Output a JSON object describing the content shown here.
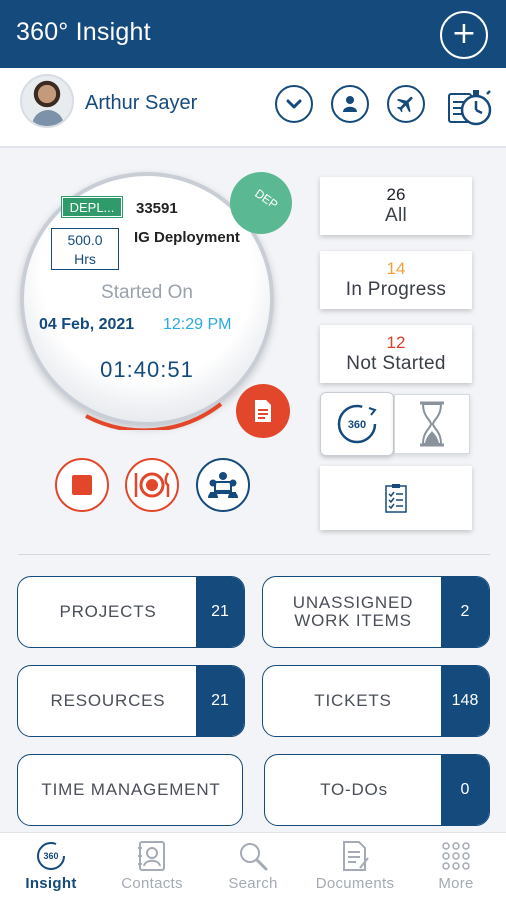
{
  "header": {
    "title": "360° Insight"
  },
  "user": {
    "name": "Arthur Sayer"
  },
  "task": {
    "tag": "DEPL...",
    "id": "33591",
    "badge": "DEP",
    "hours_value": "500.0",
    "hours_unit": "Hrs",
    "project": "IG Deployment",
    "started_label": "Started On",
    "started_date": "04 Feb, 2021",
    "started_time": "12:29 PM",
    "elapsed": "01:40:51"
  },
  "stats": [
    {
      "count": "26",
      "label": "All",
      "color": "#1d2128"
    },
    {
      "count": "14",
      "label": "In Progress",
      "color": "#f0a13a"
    },
    {
      "count": "12",
      "label": "Not Started",
      "color": "#d9412b"
    }
  ],
  "toggle": {
    "left_label": "360"
  },
  "tiles": {
    "projects": {
      "label": "PROJECTS",
      "count": "21"
    },
    "unassigned": {
      "label_line1": "UNASSIGNED",
      "label_line2": "WORK ITEMS",
      "count": "2"
    },
    "resources": {
      "label": "RESOURCES",
      "count": "21"
    },
    "tickets": {
      "label": "TICKETS",
      "count": "148"
    },
    "time_management": {
      "label": "TIME MANAGEMENT"
    },
    "todos": {
      "label": "TO-DOs",
      "count": "0"
    }
  },
  "nav": {
    "insight": "Insight",
    "insight_icon_text": "360",
    "contacts": "Contacts",
    "search": "Search",
    "documents": "Documents",
    "more": "More"
  },
  "colors": {
    "primary": "#154a7c",
    "accent_red": "#e2472b",
    "accent_green": "#2f9a6a",
    "light_blue": "#29a9e1"
  }
}
